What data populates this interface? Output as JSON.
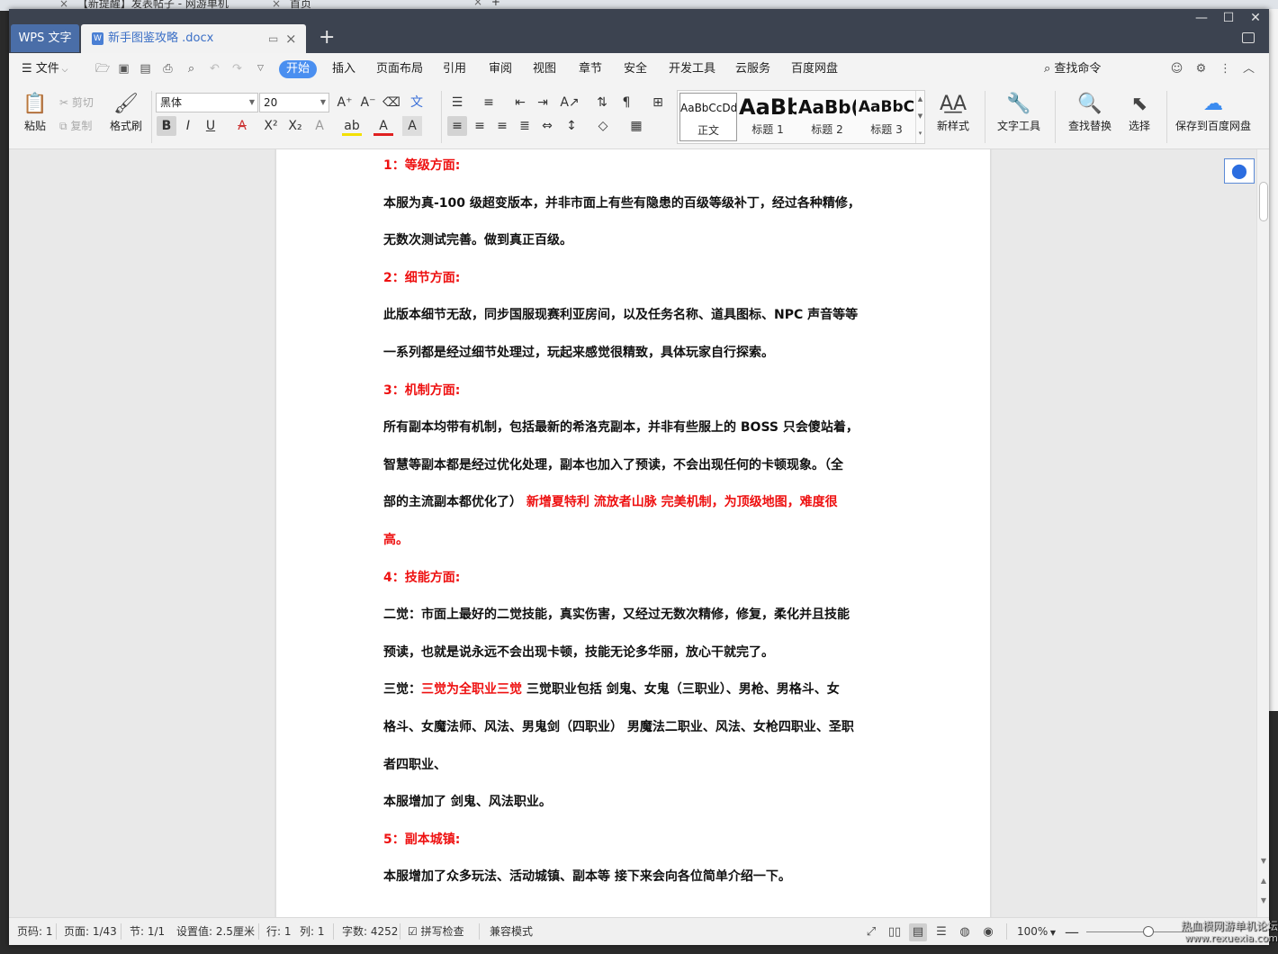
{
  "browser": {
    "tabs": [
      {
        "close": "×",
        "label": "【新提醒】发表帖子 - 网游单机"
      },
      {
        "close": "×",
        "label": "首页"
      },
      {
        "close": "×",
        "label": "+"
      }
    ]
  },
  "titlebar": {
    "app_tab": "WPS 文字",
    "doc_tab": "新手图鉴攻略 .docx",
    "doc_icon": "W",
    "new_tab": "+",
    "close": "×",
    "pin": "▭"
  },
  "menubar": {
    "file": "文件",
    "items": [
      "开始",
      "插入",
      "页面布局",
      "引用",
      "审阅",
      "视图",
      "章节",
      "安全",
      "开发工具",
      "云服务",
      "百度网盘"
    ],
    "search_command": "查找命令"
  },
  "ribbon": {
    "paste": "粘贴",
    "cut": "剪切",
    "copy": "复制",
    "format_painter": "格式刷",
    "font_name": "黑体",
    "font_size": "20",
    "styles": [
      {
        "preview": "AaBbCcDd",
        "name": "正文"
      },
      {
        "preview": "AaBb",
        "name": "标题 1"
      },
      {
        "preview": "AaBb(",
        "name": "标题 2"
      },
      {
        "preview": "AaBbC",
        "name": "标题 3"
      }
    ],
    "new_style": "新样式",
    "text_tools": "文字工具",
    "find_replace": "查找替换",
    "select": "选择",
    "save_baidu": "保存到百度网盘"
  },
  "document": {
    "paragraphs": [
      {
        "parts": [
          {
            "text": "1：等级方面:",
            "red": true
          }
        ]
      },
      {
        "parts": [
          {
            "text": "本服为真-100 级超变版本，并非市面上有些有隐患的百级等级补丁，经过各种精修，"
          }
        ]
      },
      {
        "parts": [
          {
            "text": "无数次测试完善。做到真正百级。"
          }
        ]
      },
      {
        "parts": [
          {
            "text": "2：细节方面:",
            "red": true
          }
        ]
      },
      {
        "parts": [
          {
            "text": "此版本细节无敌，同步国服现赛利亚房间，以及任务名称、道具图标、NPC 声音等等"
          }
        ]
      },
      {
        "parts": [
          {
            "text": "一系列都是经过细节处理过，玩起来感觉很精致，具体玩家自行探索。"
          }
        ]
      },
      {
        "parts": [
          {
            "text": "3：机制方面:",
            "red": true
          }
        ]
      },
      {
        "parts": [
          {
            "text": "所有副本均带有机制，包括最新的希洛克副本，并非有些服上的 BOSS 只会傻站着，"
          }
        ]
      },
      {
        "parts": [
          {
            "text": "智慧等副本都是经过优化处理，副本也加入了预读，不会出现任何的卡顿现象。（全"
          }
        ]
      },
      {
        "parts": [
          {
            "text": "部的主流副本都优化了）"
          },
          {
            "text": " 新增夏特利 流放者山脉 完美机制，为顶级地图，难度很",
            "red": true
          }
        ]
      },
      {
        "parts": [
          {
            "text": "高。",
            "red": true
          }
        ]
      },
      {
        "parts": [
          {
            "text": "4：技能方面:",
            "red": true
          }
        ]
      },
      {
        "parts": [
          {
            "text": "二觉：市面上最好的二觉技能，真实伤害，又经过无数次精修，修复，柔化并且技能"
          }
        ]
      },
      {
        "parts": [
          {
            "text": "预读，也就是说永远不会出现卡顿，技能无论多华丽，放心干就完了。"
          }
        ]
      },
      {
        "parts": [
          {
            "text": "三觉："
          },
          {
            "text": "三觉为全职业三觉",
            "red": true
          },
          {
            "text": " 三觉职业包括  剑鬼、女鬼（三职业）、男枪、男格斗、女"
          }
        ]
      },
      {
        "parts": [
          {
            "text": "格斗、女魔法师、风法、男鬼剑（四职业）  男魔法二职业、风法、女枪四职业、圣职"
          }
        ]
      },
      {
        "parts": [
          {
            "text": "者四职业、"
          }
        ]
      },
      {
        "parts": [
          {
            "text": "本服增加了 剑鬼、风法职业。"
          }
        ]
      },
      {
        "parts": [
          {
            "text": "5：副本城镇:",
            "red": true
          }
        ]
      },
      {
        "parts": [
          {
            "text": "本服增加了众多玩法、活动城镇、副本等 接下来会向各位简单介绍一下。"
          }
        ]
      }
    ]
  },
  "statusbar": {
    "page_code": "页码: 1",
    "page": "页面: 1/43",
    "section": "节: 1/1",
    "setting": "设置值: 2.5厘米",
    "row": "行: 1",
    "col": "列: 1",
    "words": "字数: 4252",
    "spellcheck": "拼写检查",
    "compat": "兼容模式",
    "zoom": "100%",
    "zoom_level": 1.0
  },
  "watermark": {
    "line1": "热血模网游单机论坛",
    "line2": "www.rexuexia.com"
  },
  "colors": {
    "titlebar": "#3c4350",
    "accent": "#4a8ff0",
    "heading_red": "#ee1111"
  }
}
